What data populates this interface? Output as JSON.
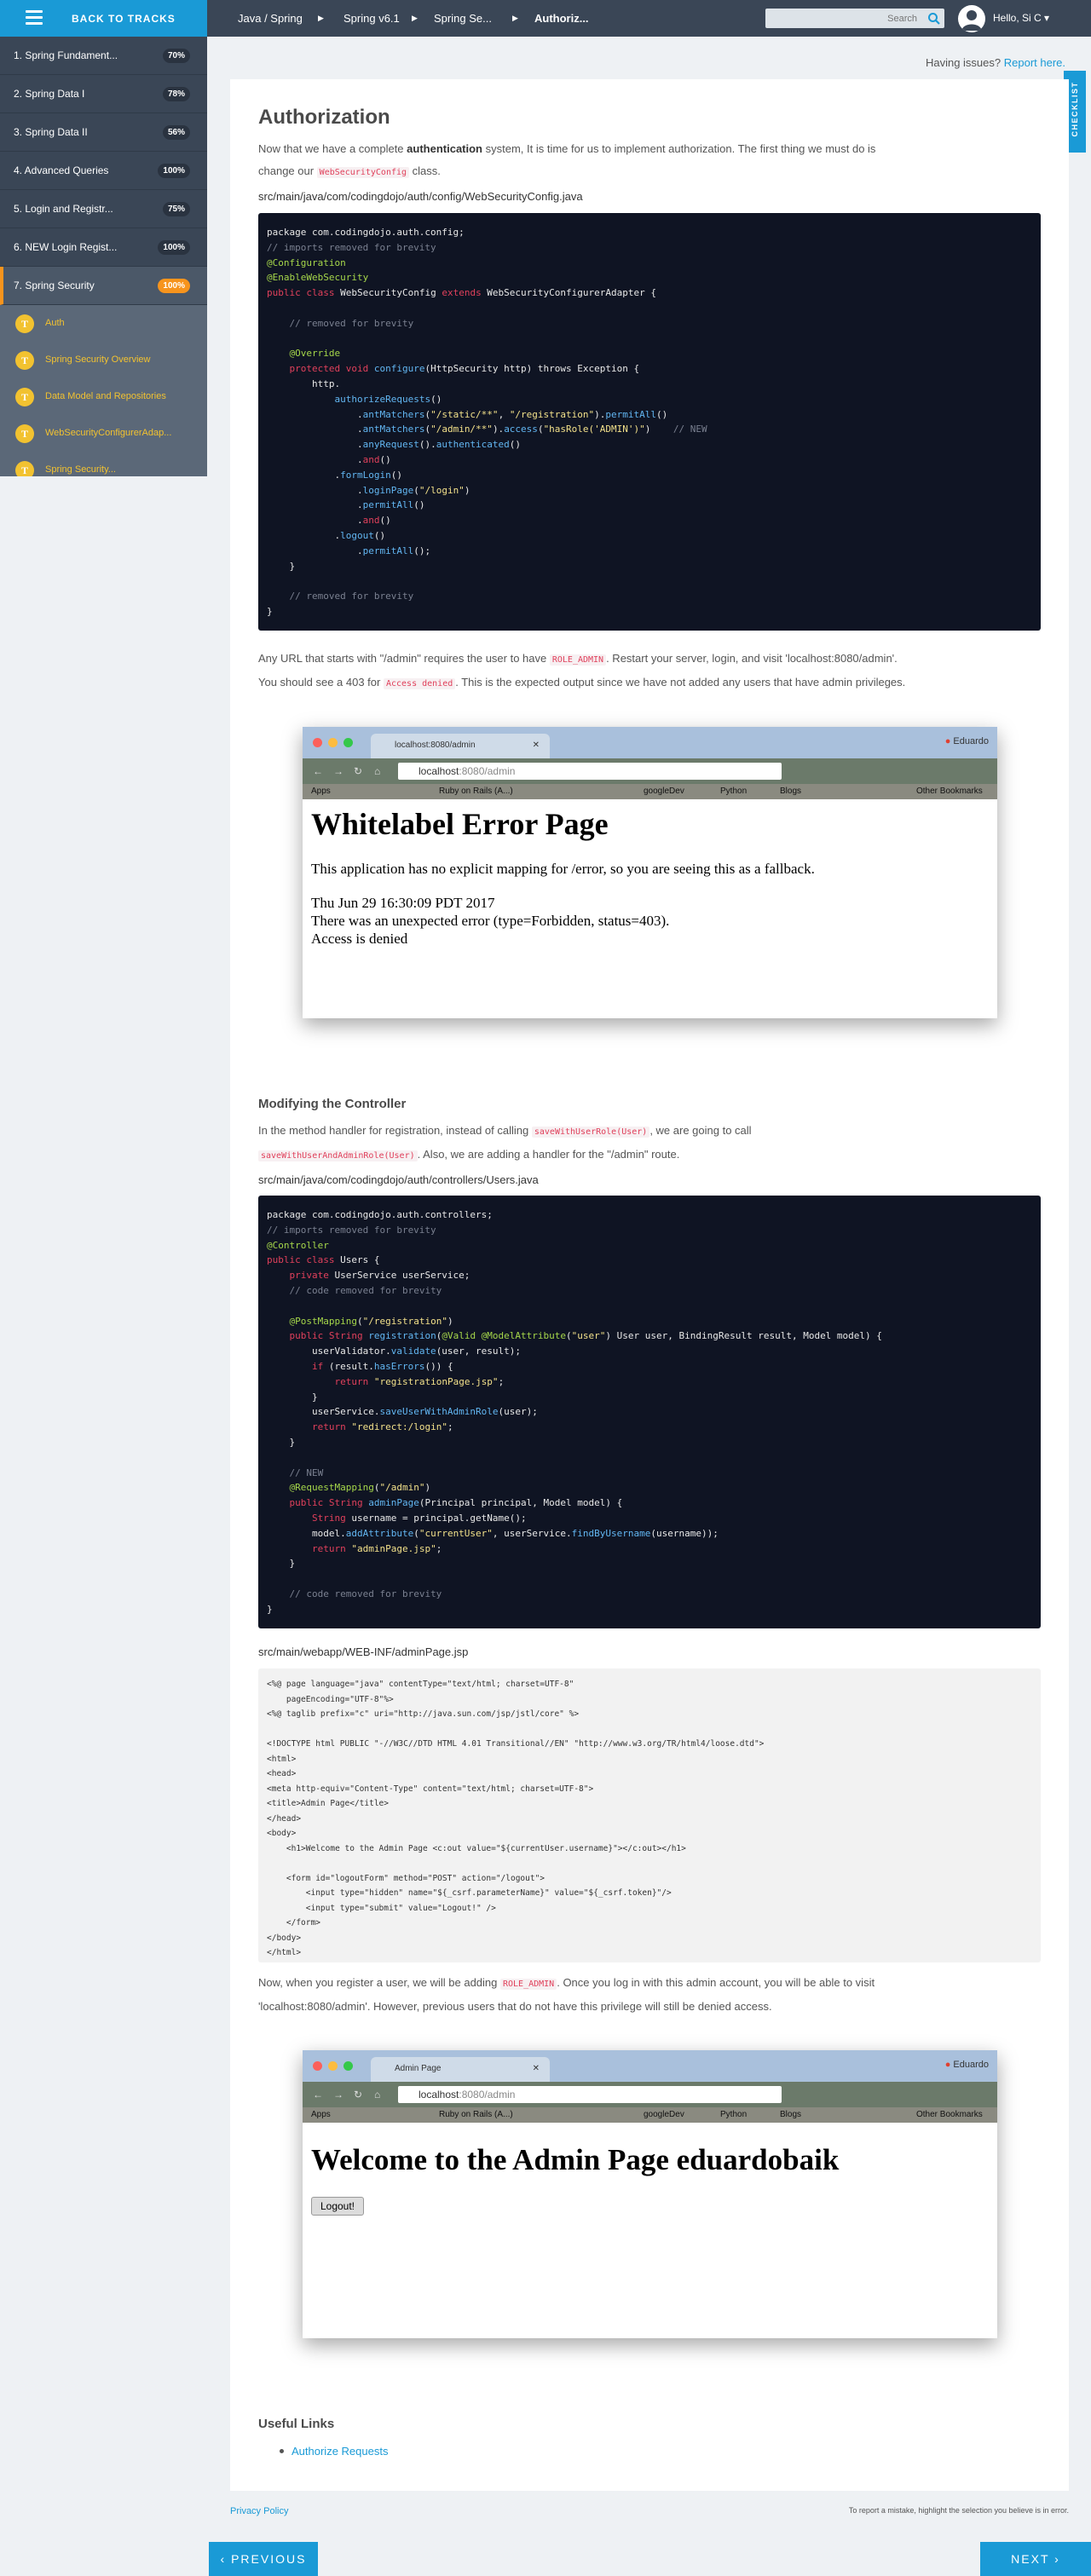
{
  "topbar": {
    "back_label": "BACK TO TRACKS",
    "breadcrumbs": [
      "Java / Spring",
      "Spring v6.1",
      "Spring Se...",
      "Authoriz..."
    ],
    "search_placeholder": "Search",
    "greeting": "Hello, Si C"
  },
  "sidebar": {
    "items": [
      {
        "label": "1. Spring Fundament...",
        "badge": "70%"
      },
      {
        "label": "2. Spring Data I",
        "badge": "78%"
      },
      {
        "label": "3. Spring Data II",
        "badge": "56%"
      },
      {
        "label": "4. Advanced Queries",
        "badge": "100%"
      },
      {
        "label": "5. Login and Registr...",
        "badge": "75%"
      },
      {
        "label": "6. NEW Login Regist...",
        "badge": "100%"
      },
      {
        "label": "7. Spring Security",
        "badge": "100%"
      }
    ],
    "subitems": [
      {
        "icon": "T",
        "label": "Auth"
      },
      {
        "icon": "T",
        "label": "Spring Security Overview"
      },
      {
        "icon": "T",
        "label": "Data Model and Repositories"
      },
      {
        "icon": "T",
        "label": "WebSecurityConfigurerAdap..."
      },
      {
        "icon": "T",
        "label": "Spring Security..."
      }
    ]
  },
  "checklist_label": "CHECKLIST",
  "issues": {
    "text": "Having issues?",
    "link": "Report here."
  },
  "content": {
    "title": "Authorization",
    "intro_1": "Now that we have a complete ",
    "intro_bold": "authentication",
    "intro_2": " system, It is time for us to implement authorization. The first thing we must do is",
    "intro_3": "change our ",
    "intro_code": "WebSecurityConfig",
    "intro_4": " class.",
    "file1": "src/main/java/com/codingdojo/auth/config/WebSecurityConfig.java",
    "after1_a": "Any URL that starts with \"/admin\" requires the user to have ",
    "after1_code": "ROLE_ADMIN",
    "after1_b": ". Restart your server, login, and visit 'localhost:8080/admin'.",
    "after1_c": "You should see a 403 for ",
    "after1_code2": "Access denied",
    "after1_d": ". This is the expected output since we have not added any users that have admin privileges.",
    "h_modify": "Modifying the Controller",
    "modify_a": "In the method handler for registration, instead of calling ",
    "modify_code1": "saveWithUserRole(User)",
    "modify_b": ", we are going to call",
    "modify_code2": "saveWithUserAndAdminRole(User)",
    "modify_c": ". Also, we are adding a handler for the \"/admin\" route.",
    "file2": "src/main/java/com/codingdojo/auth/controllers/Users.java",
    "file3": "src/main/webapp/WEB-INF/adminPage.jsp",
    "after3_a": "Now, when you register a user, we will be adding ",
    "after3_code": "ROLE_ADMIN",
    "after3_b": ". Once you log in with this admin account, you will be able to visit",
    "after3_c": "'localhost:8080/admin'. However, previous users that do not have this privilege will still be denied access.",
    "useful_title": "Useful Links",
    "useful_link": "Authorize Requests"
  },
  "screenshot1": {
    "tab_title": "localhost:8080/admin",
    "user": "Eduardo",
    "url_host": "localhost",
    "url_path": ":8080/admin",
    "bookmarks": [
      "Apps",
      "Ruby on Rails (A...)",
      "googleDev",
      "Python",
      "Blogs",
      "Other Bookmarks"
    ],
    "heading": "Whitelabel Error Page",
    "line1": "This application has no explicit mapping for /error, so you are seeing this as a fallback.",
    "line2": "Thu Jun 29 16:30:09 PDT 2017",
    "line3": "There was an unexpected error (type=Forbidden, status=403).",
    "line4": "Access is denied"
  },
  "screenshot2": {
    "tab_title": "Admin Page",
    "user": "Eduardo",
    "url_host": "localhost",
    "url_path": ":8080/admin",
    "bookmarks": [
      "Apps",
      "Ruby on Rails (A...)",
      "googleDev",
      "Python",
      "Blogs",
      "Other Bookmarks"
    ],
    "heading": "Welcome to the Admin Page eduardobaik",
    "button": "Logout!"
  },
  "footer": {
    "privacy": "Privacy Policy",
    "report": "To report a mistake, highlight the selection you believe is in error.",
    "previous": "PREVIOUS",
    "next": "NEXT"
  },
  "colors": {
    "accent": "#1a9ad6",
    "progress": "#f7941d",
    "sidebar": "#3a4656"
  }
}
